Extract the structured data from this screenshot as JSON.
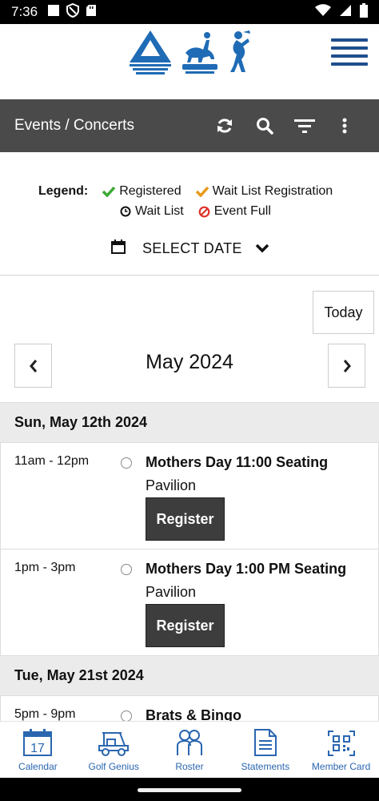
{
  "status_bar": {
    "time": "7:36"
  },
  "header": {
    "menu_icon": "hamburger-icon"
  },
  "toolbar": {
    "title": "Events / Concerts",
    "icons": [
      "refresh-icon",
      "search-icon",
      "filter-icon",
      "more-vert-icon"
    ]
  },
  "legend": {
    "title": "Legend:",
    "registered": "Registered",
    "wait_list_registration": "Wait List Registration",
    "wait_list": "Wait List",
    "event_full": "Event Full"
  },
  "date_select": {
    "label": "SELECT DATE"
  },
  "calendar": {
    "today_label": "Today",
    "month_label": "May 2024"
  },
  "events": [
    {
      "date": "Sun, May 12th 2024",
      "items": [
        {
          "time": "11am - 12pm",
          "name": "Mothers Day 11:00 Seating",
          "location": "Pavilion",
          "button": "Register"
        },
        {
          "time": "1pm - 3pm",
          "name": "Mothers Day 1:00 PM Seating",
          "location": "Pavilion",
          "button": "Register"
        }
      ]
    },
    {
      "date": "Tue, May 21st 2024",
      "items": [
        {
          "time": "5pm - 9pm",
          "name": "Brats & Bingo"
        }
      ]
    }
  ],
  "bottom_nav": [
    {
      "label": "Calendar",
      "icon": "calendar-icon",
      "day": "17"
    },
    {
      "label": "Golf Genius",
      "icon": "golf-cart-icon"
    },
    {
      "label": "Roster",
      "icon": "roster-icon"
    },
    {
      "label": "Statements",
      "icon": "statements-icon"
    },
    {
      "label": "Member Card",
      "icon": "qr-code-icon"
    }
  ],
  "colors": {
    "toolbar_bg": "#4a4a4a",
    "brand_blue": "#1f4e8c",
    "nav_blue": "#2a66b0",
    "registered_green": "#3aaa35",
    "waitlist_orange": "#e69a1c",
    "full_red": "#e0302b",
    "register_button": "#3d3d3d"
  }
}
